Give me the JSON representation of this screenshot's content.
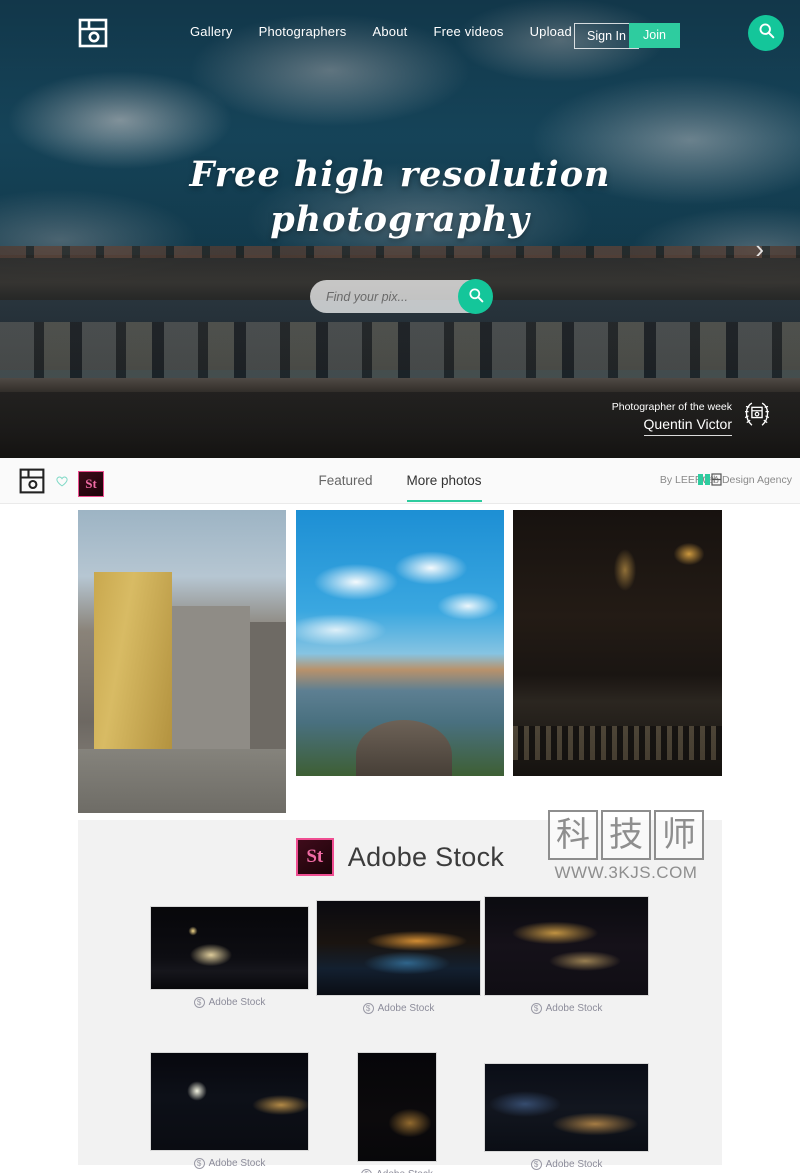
{
  "nav": {
    "logo_icon": "camera-logo-icon",
    "links": [
      {
        "label": "Gallery"
      },
      {
        "label": "Photographers"
      },
      {
        "label": "About"
      },
      {
        "label": "Free videos"
      },
      {
        "label": "Upload"
      }
    ],
    "sign_in_label": "Sign In",
    "join_label": "Join",
    "search_icon": "search-icon"
  },
  "hero": {
    "title_line1": "Free high resolution",
    "title_line2": "photography",
    "search_placeholder": "Find your pix...",
    "search_value": "",
    "search_icon": "search-icon",
    "next_arrow": "›",
    "photographer_label": "Photographer of the week",
    "photographer_name": "Quentin Victor",
    "award_icon": "laurel-wreath-award-icon"
  },
  "tabbar": {
    "logo_icon": "camera-logo-icon",
    "heart_icon": "heart-icon",
    "stock_badge": "St",
    "tabs": [
      {
        "label": "Featured",
        "active": false
      },
      {
        "label": "More photos",
        "active": true
      }
    ],
    "byline_prefix": "By LEEROY",
    "byline_suffix": "Web Design Agency",
    "byline_logo_icon": "leeroy-logo-icon"
  },
  "gallery": {
    "items": [
      {
        "name": "porto-street-buildings-photo",
        "alt": "Yellow tiled buildings on a Porto street with two people in raincoats"
      },
      {
        "name": "harbor-blue-sky-photo",
        "alt": "Harbor with boats under a bright blue sky with clouds"
      },
      {
        "name": "dark-wine-bar-photo",
        "alt": "Dark interior of a wine bar with bottles"
      }
    ]
  },
  "stock": {
    "logo_badge": "St",
    "title": "Adobe Stock",
    "caption": "Adobe Stock",
    "price_icon": "dollar-circle-icon",
    "thumbnails": [
      {
        "name": "night-plaza-lit-buildings-thumb"
      },
      {
        "name": "night-harbor-city-lights-thumb"
      },
      {
        "name": "night-aerial-city-lights-thumb"
      },
      {
        "name": "night-dock-blue-cranes-thumb"
      },
      {
        "name": "night-dark-tower-thumb"
      },
      {
        "name": "night-downtown-skyline-thumb"
      }
    ]
  },
  "watermark": {
    "chars": [
      "科",
      "技",
      "师"
    ],
    "url": "WWW.3KJS.COM"
  },
  "colors": {
    "accent_teal": "#2ecc9f",
    "search_teal": "#14c69a",
    "stock_pink": "#ef4e92",
    "hero_blue": "#1a5068"
  }
}
